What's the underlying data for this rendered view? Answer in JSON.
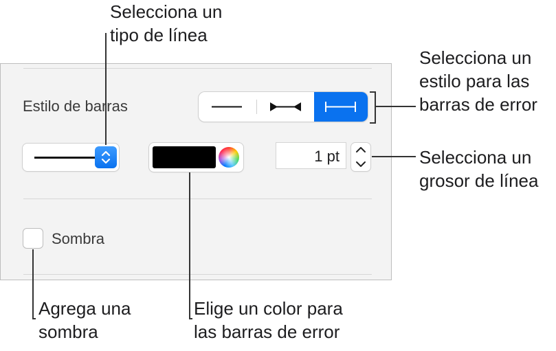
{
  "callouts": {
    "line_type": "Selecciona un\ntipo de línea",
    "bar_style": "Selecciona un\nestilo para las\nbarras de error",
    "line_width": "Selecciona un\ngrosor de línea",
    "shadow": "Agrega una\nsombra",
    "color": "Elige un color para\nlas barras de error"
  },
  "panel": {
    "bar_style_label": "Estilo de barras",
    "bar_style_options": [
      "line-only",
      "arrow-ends",
      "capped-ends"
    ],
    "bar_style_selected": "capped-ends",
    "line_style_value": "solid-line",
    "color_value": "#000000",
    "width_value": "1 pt",
    "shadow_label": "Sombra",
    "shadow_checked": false
  },
  "colors": {
    "accent": "#0a72ef",
    "panel_bg": "#f3f3f3"
  }
}
